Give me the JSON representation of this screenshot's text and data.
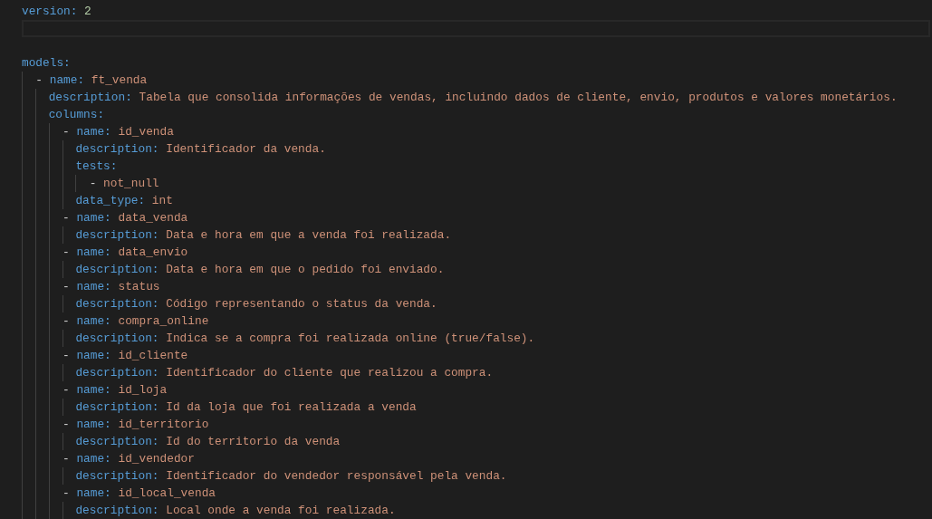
{
  "document": [
    {
      "kind": "pair",
      "key": "version:",
      "number": "2"
    },
    {
      "kind": "current_line"
    },
    {
      "kind": "blank"
    },
    {
      "kind": "pair",
      "key": "models:",
      "children": [
        {
          "kind": "item",
          "marker": "-",
          "entries": [
            {
              "kind": "pair",
              "key": "name:",
              "string": "ft_venda"
            },
            {
              "kind": "pair",
              "key": "description:",
              "string": "Tabela que consolida informações de vendas, incluindo dados de cliente, envio, produtos e valores monetários."
            },
            {
              "kind": "pair",
              "key": "columns:",
              "children": [
                {
                  "kind": "item",
                  "marker": "-",
                  "entries": [
                    {
                      "kind": "pair",
                      "key": "name:",
                      "string": "id_venda"
                    },
                    {
                      "kind": "pair",
                      "key": "description:",
                      "string": "Identificador da venda."
                    },
                    {
                      "kind": "pair",
                      "key": "tests:",
                      "children": [
                        {
                          "kind": "item",
                          "marker": "-",
                          "string": "not_null"
                        }
                      ]
                    },
                    {
                      "kind": "pair",
                      "key": "data_type:",
                      "string": "int"
                    }
                  ]
                },
                {
                  "kind": "item",
                  "marker": "-",
                  "entries": [
                    {
                      "kind": "pair",
                      "key": "name:",
                      "string": "data_venda"
                    },
                    {
                      "kind": "pair",
                      "key": "description:",
                      "string": "Data e hora em que a venda foi realizada."
                    }
                  ]
                },
                {
                  "kind": "item",
                  "marker": "-",
                  "entries": [
                    {
                      "kind": "pair",
                      "key": "name:",
                      "string": "data_envio"
                    },
                    {
                      "kind": "pair",
                      "key": "description:",
                      "string": "Data e hora em que o pedido foi enviado."
                    }
                  ]
                },
                {
                  "kind": "item",
                  "marker": "-",
                  "entries": [
                    {
                      "kind": "pair",
                      "key": "name:",
                      "string": "status"
                    },
                    {
                      "kind": "pair",
                      "key": "description:",
                      "string": "Código representando o status da venda."
                    }
                  ]
                },
                {
                  "kind": "item",
                  "marker": "-",
                  "entries": [
                    {
                      "kind": "pair",
                      "key": "name:",
                      "string": "compra_online"
                    },
                    {
                      "kind": "pair",
                      "key": "description:",
                      "string": "Indica se a compra foi realizada online (true/false)."
                    }
                  ]
                },
                {
                  "kind": "item",
                  "marker": "-",
                  "entries": [
                    {
                      "kind": "pair",
                      "key": "name:",
                      "string": "id_cliente"
                    },
                    {
                      "kind": "pair",
                      "key": "description:",
                      "string": "Identificador do cliente que realizou a compra."
                    }
                  ]
                },
                {
                  "kind": "item",
                  "marker": "-",
                  "entries": [
                    {
                      "kind": "pair",
                      "key": "name:",
                      "string": "id_loja"
                    },
                    {
                      "kind": "pair",
                      "key": "description:",
                      "string": "Id da loja que foi realizada a venda"
                    }
                  ]
                },
                {
                  "kind": "item",
                  "marker": "-",
                  "entries": [
                    {
                      "kind": "pair",
                      "key": "name:",
                      "string": "id_territorio"
                    },
                    {
                      "kind": "pair",
                      "key": "description:",
                      "string": "Id do territorio da venda"
                    }
                  ]
                },
                {
                  "kind": "item",
                  "marker": "-",
                  "entries": [
                    {
                      "kind": "pair",
                      "key": "name:",
                      "string": "id_vendedor"
                    },
                    {
                      "kind": "pair",
                      "key": "description:",
                      "string": "Identificador do vendedor responsável pela venda."
                    }
                  ]
                },
                {
                  "kind": "item",
                  "marker": "-",
                  "entries": [
                    {
                      "kind": "pair",
                      "key": "name:",
                      "string": "id_local_venda"
                    },
                    {
                      "kind": "pair",
                      "key": "description:",
                      "string": "Local onde a venda foi realizada."
                    }
                  ]
                }
              ]
            }
          ]
        }
      ]
    }
  ]
}
